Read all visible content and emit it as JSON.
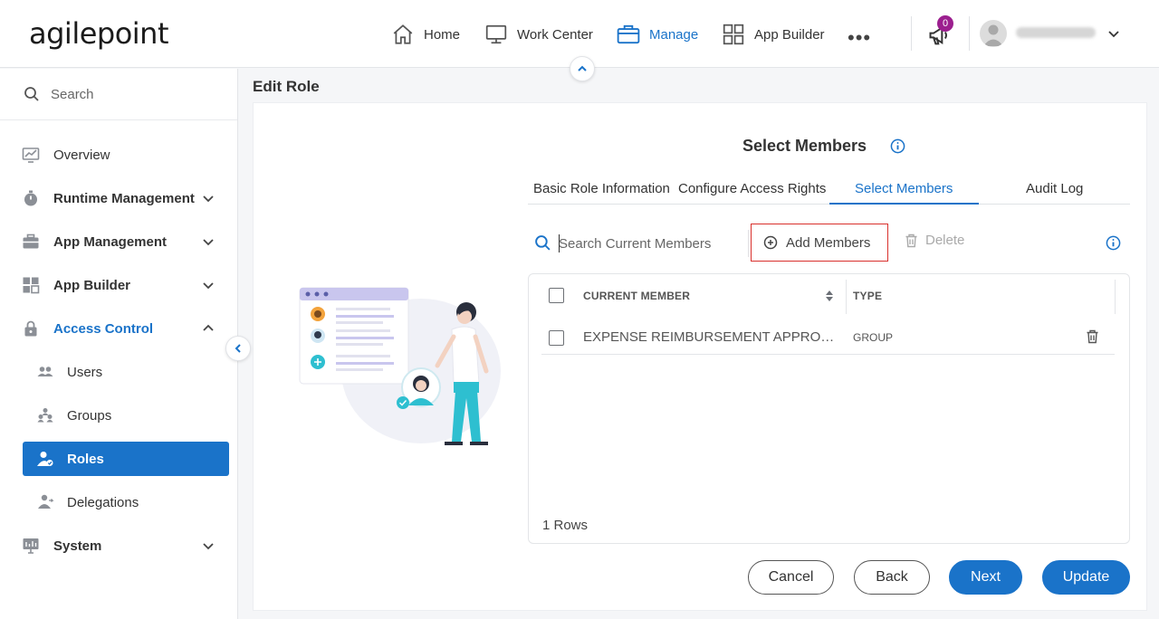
{
  "header": {
    "logo": "agilepoint",
    "nav": [
      {
        "label": "Home",
        "icon": "home-icon"
      },
      {
        "label": "Work Center",
        "icon": "monitor-icon"
      },
      {
        "label": "Manage",
        "icon": "briefcase-icon",
        "active": true
      },
      {
        "label": "App Builder",
        "icon": "grid-icon"
      }
    ],
    "more": "•••",
    "notifications_count": "0"
  },
  "sidebar": {
    "search_placeholder": "Search",
    "items": [
      {
        "label": "Overview",
        "icon": "chart-icon"
      },
      {
        "label": "Runtime Management",
        "icon": "stopwatch-icon",
        "expandable": true
      },
      {
        "label": "App Management",
        "icon": "toolbox-icon",
        "expandable": true
      },
      {
        "label": "App Builder",
        "icon": "apps-icon",
        "expandable": true
      },
      {
        "label": "Access Control",
        "icon": "lock-icon",
        "expanded": true
      },
      {
        "label": "Users",
        "icon": "users-icon"
      },
      {
        "label": "Groups",
        "icon": "groups-icon"
      },
      {
        "label": "Roles",
        "icon": "roles-icon",
        "active": true
      },
      {
        "label": "Delegations",
        "icon": "delegation-icon"
      },
      {
        "label": "System",
        "icon": "system-icon",
        "expandable": true
      }
    ]
  },
  "page": {
    "title": "Edit Role",
    "section_title": "Select Members",
    "tabs": [
      {
        "label": "Basic Role Information"
      },
      {
        "label": "Configure Access Rights"
      },
      {
        "label": "Select Members",
        "active": true
      },
      {
        "label": "Audit Log"
      }
    ],
    "toolbar": {
      "search_placeholder": "Search Current Members",
      "add_label": "Add Members",
      "delete_label": "Delete"
    },
    "table": {
      "columns": [
        "CURRENT MEMBER",
        "TYPE"
      ],
      "rows": [
        {
          "member": "EXPENSE REIMBURSEMENT APPROVERS",
          "type": "GROUP"
        }
      ],
      "row_count": "1 Rows"
    },
    "buttons": {
      "cancel": "Cancel",
      "back": "Back",
      "next": "Next",
      "update": "Update"
    }
  },
  "colors": {
    "accent": "#1a73c9",
    "highlight_border": "#d9302c",
    "badge": "#9c1f8f"
  }
}
